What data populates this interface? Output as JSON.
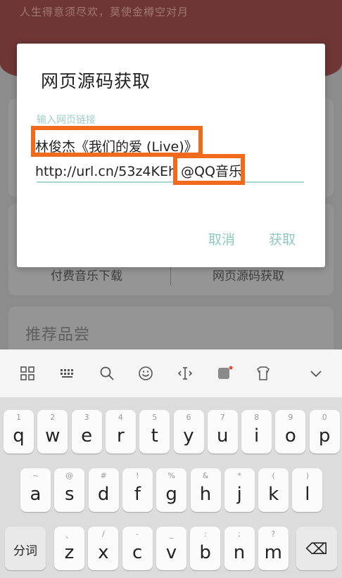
{
  "background": {
    "slogan": "人生得意须尽欢，莫使金樽空对月",
    "paid_music_btn": "付费音乐下载",
    "source_btn": "网页源码获取",
    "section_title": "推荐品尝"
  },
  "dialog": {
    "title": "网页源码获取",
    "field_label": "输入网页链接",
    "field_value_line1": "林俊杰《我们的爱 (Live)》",
    "field_value_line2": "http://url.cn/53z4KEh @QQ音乐",
    "cancel_label": "取消",
    "get_label": "获取"
  },
  "keyboard": {
    "toolbar": [
      "grid-icon",
      "keyboard-icon",
      "search-icon",
      "emoji-icon",
      "cursor-icon",
      "skin-icon",
      "clipboard-icon",
      "collapse-icon"
    ],
    "row1": [
      {
        "k": "q",
        "n": "1"
      },
      {
        "k": "w",
        "n": "2"
      },
      {
        "k": "e",
        "n": "3"
      },
      {
        "k": "r",
        "n": "4"
      },
      {
        "k": "t",
        "n": "5"
      },
      {
        "k": "y",
        "n": "6"
      },
      {
        "k": "u",
        "n": "7"
      },
      {
        "k": "i",
        "n": "8"
      },
      {
        "k": "o",
        "n": "9"
      },
      {
        "k": "p",
        "n": "0"
      }
    ],
    "row2": [
      {
        "k": "a",
        "n": "~"
      },
      {
        "k": "s",
        "n": "@"
      },
      {
        "k": "d",
        "n": "#"
      },
      {
        "k": "f",
        "n": "!"
      },
      {
        "k": "g",
        "n": "%"
      },
      {
        "k": "h",
        "n": "&"
      },
      {
        "k": "j",
        "n": "*"
      },
      {
        "k": "k",
        "n": "("
      },
      {
        "k": "l",
        "n": ")"
      }
    ],
    "row3": [
      {
        "k": "z",
        "n": "、"
      },
      {
        "k": "x",
        "n": "/"
      },
      {
        "k": "c",
        "n": "-"
      },
      {
        "k": "v",
        "n": "_"
      },
      {
        "k": "b",
        "n": ":"
      },
      {
        "k": "n",
        "n": ";"
      },
      {
        "k": "m",
        "n": "?"
      }
    ],
    "segment_label": "分词",
    "delete_symbol": "⌫"
  }
}
